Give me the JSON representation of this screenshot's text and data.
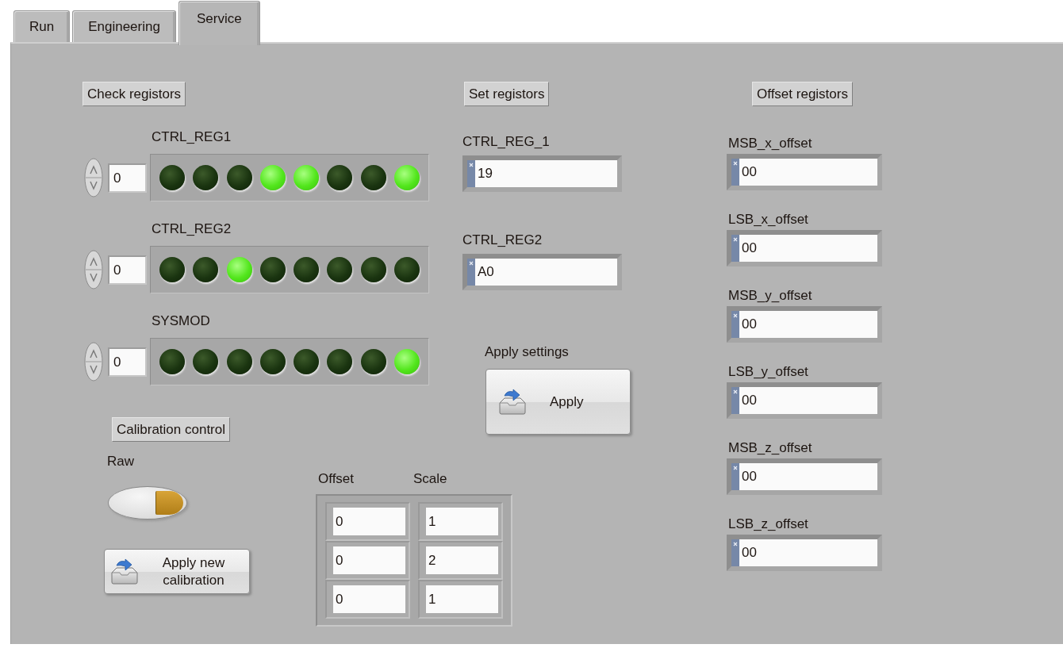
{
  "tabs": [
    {
      "label": "Run",
      "selected": false
    },
    {
      "label": "Engineering",
      "selected": false
    },
    {
      "label": "Service",
      "selected": true
    }
  ],
  "check_registers": {
    "heading": "Check registors",
    "rows": [
      {
        "label": "CTRL_REG1",
        "index": "0",
        "leds": [
          false,
          false,
          false,
          true,
          true,
          false,
          false,
          true
        ]
      },
      {
        "label": "CTRL_REG2",
        "index": "0",
        "leds": [
          false,
          false,
          true,
          false,
          false,
          false,
          false,
          false
        ]
      },
      {
        "label": "SYSMOD",
        "index": "0",
        "leds": [
          false,
          false,
          false,
          false,
          false,
          false,
          false,
          true
        ]
      }
    ]
  },
  "calibration": {
    "heading": "Calibration control",
    "switch": {
      "label": "Raw",
      "on": true
    },
    "button": "Apply new calibration",
    "table": {
      "columns": [
        "Offset",
        "Scale"
      ],
      "rows": [
        [
          "0",
          "1"
        ],
        [
          "0",
          "2"
        ],
        [
          "0",
          "1"
        ]
      ]
    }
  },
  "set_registers": {
    "heading": "Set registors",
    "fields": [
      {
        "label": "CTRL_REG_1",
        "value": "19"
      },
      {
        "label": "CTRL_REG2",
        "value": "A0"
      }
    ],
    "apply": {
      "label": "Apply settings",
      "button": "Apply"
    }
  },
  "offset_registers": {
    "heading": "Offset registors",
    "fields": [
      {
        "label": "MSB_x_offset",
        "value": "00"
      },
      {
        "label": "LSB_x_offset",
        "value": "00"
      },
      {
        "label": "MSB_y_offset",
        "value": "00"
      },
      {
        "label": "LSB_y_offset",
        "value": "00"
      },
      {
        "label": "MSB_z_offset",
        "value": "00"
      },
      {
        "label": "LSB_z_offset",
        "value": "00"
      }
    ]
  }
}
